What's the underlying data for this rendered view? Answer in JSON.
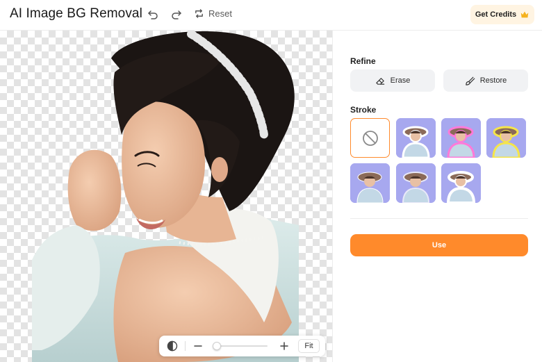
{
  "header": {
    "title": "AI Image BG Removal",
    "undo_icon": "undo-icon",
    "redo_icon": "redo-icon",
    "reset_label": "Reset",
    "reset_icon": "reset-icon",
    "credits_label": "Get Credits",
    "credits_icon": "crown-icon"
  },
  "canvas": {
    "background": "transparent-checkerboard",
    "subject": "woman-with-hair-accessory-cutout"
  },
  "zoombar": {
    "compare_icon": "compare-icon",
    "zoom_out_icon": "minus-icon",
    "zoom_in_icon": "plus-icon",
    "zoom_level": 0.05,
    "fit_label": "Fit"
  },
  "panel": {
    "refine_label": "Refine",
    "erase_label": "Erase",
    "restore_label": "Restore",
    "stroke_label": "Stroke",
    "stroke_options": [
      {
        "name": "none",
        "selected": true,
        "icon": "no-stroke-icon"
      },
      {
        "name": "white-stroke",
        "selected": false,
        "color": "#ffffff"
      },
      {
        "name": "pink-stroke",
        "selected": false,
        "color": "#ff7ad9"
      },
      {
        "name": "yellow-stroke",
        "selected": false,
        "color": "#f5e54a"
      },
      {
        "name": "thin-white-stroke",
        "selected": false,
        "color": "#ffffff"
      },
      {
        "name": "light-stroke",
        "selected": false,
        "color": "#e8e8f8"
      },
      {
        "name": "white-thick-stroke",
        "selected": false,
        "color": "#ffffff"
      }
    ],
    "use_label": "Use"
  },
  "colors": {
    "accent": "#ff8a2b",
    "credits_bg": "#fff4e2",
    "button_bg": "#f1f2f4",
    "thumb_bg": "#a7a8ef"
  }
}
